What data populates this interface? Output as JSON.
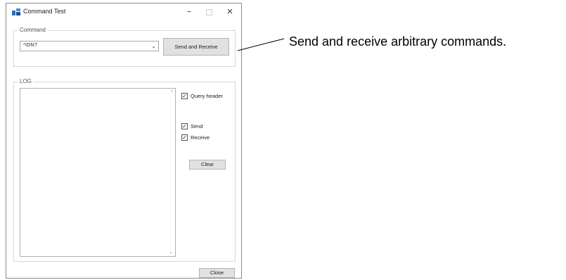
{
  "window": {
    "title": "Command Test",
    "minimize_glyph": "−",
    "close_glyph": "✕"
  },
  "command_group": {
    "label": "Command",
    "combo_value": "*IDN?",
    "send_receive_label": "Send and Receive"
  },
  "log_group": {
    "label": "LOG",
    "query_header": {
      "label": "Query header",
      "checked": true
    },
    "send": {
      "label": "Send",
      "checked": true
    },
    "receive": {
      "label": "Receive",
      "checked": true
    },
    "clear_label": "Clear"
  },
  "close_label": "Close",
  "annotation": "Send and receive arbitrary commands.",
  "icons": {
    "app": "window-app-icon",
    "dropdown": "chevron-down-icon",
    "scroll_up": "scroll-up-icon",
    "scroll_down": "scroll-down-icon",
    "check": "checkmark-icon"
  }
}
